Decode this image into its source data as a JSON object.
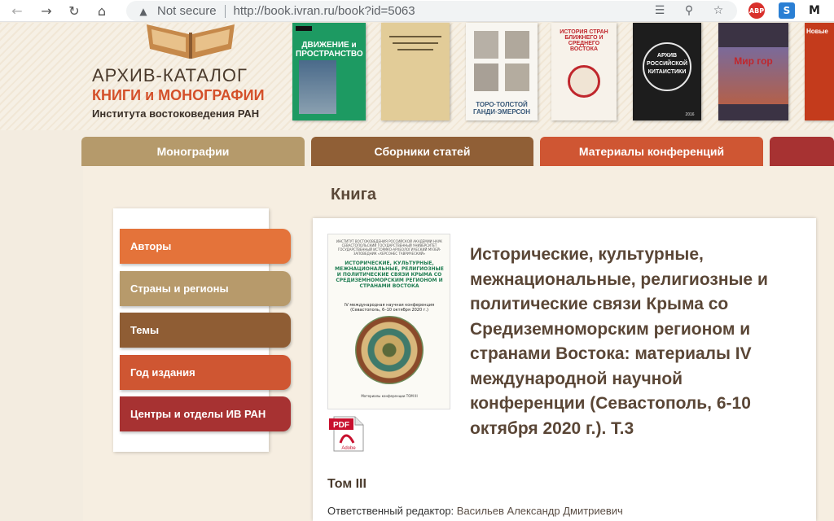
{
  "browser": {
    "not_secure": "Not secure",
    "url": "http://book.ivran.ru/book?id=5063",
    "ext_abp": "ABP",
    "ext_s": "S",
    "ext_m": "M"
  },
  "header": {
    "logo_title": "АРХИВ-КАТАЛОГ",
    "logo_sub1": "КНИГИ и МОНОГРАФИИ",
    "logo_sub2": "Института востоковедения РАН",
    "covers": [
      {
        "text": "ДВИЖЕНИЕ и ПРОСТРАНСТВО"
      },
      {
        "text": ""
      },
      {
        "text": "ТОРО·ТОЛСТОЙ ГАНДИ·ЭМЕРСОН"
      },
      {
        "text": "ИСТОРИЯ СТРАН БЛИЖНЕГО И СРЕДНЕГО ВОСТОКА"
      },
      {
        "text": "АРХИВ РОССИЙСКОЙ КИТАИСТИКИ",
        "year": "2016"
      },
      {
        "text": "Мир гор"
      },
      {
        "text": "Новые"
      }
    ]
  },
  "tabs": [
    {
      "label": "Монографии"
    },
    {
      "label": "Сборники статей"
    },
    {
      "label": "Материалы конференций"
    }
  ],
  "page": {
    "title": "Книга"
  },
  "sidebar": {
    "items": [
      {
        "label": "Авторы"
      },
      {
        "label": "Страны и регионы"
      },
      {
        "label": "Темы"
      },
      {
        "label": "Год издания"
      },
      {
        "label": "Центры и отделы ИВ РАН"
      }
    ]
  },
  "book": {
    "cover_header": "ИНСТИТУТ ВОСТОКОВЕДЕНИЯ РОССИЙСКОЙ АКАДЕМИИ НАУК СЕВАСТОПОЛЬСКИЙ ГОСУДАРСТВЕННЫЙ УНИВЕРСИТЕТ ГОСУДАРСТВЕННЫЙ ИСТОРИКО-АРХЕОЛОГИЧЕСКИЙ МУЗЕЙ-ЗАПОВЕДНИК «ХЕРСОНЕС ТАВРИЧЕСКИЙ»",
    "cover_title": "ИСТОРИЧЕСКИЕ, КУЛЬТУРНЫЕ, МЕЖНАЦИОНАЛЬНЫЕ, РЕЛИГИОЗНЫЕ И ПОЛИТИЧЕСКИЕ СВЯЗИ КРЫМА СО СРЕДИЗЕМНОМОРСКИМ РЕГИОНОМ И СТРАНАМИ ВОСТОКА",
    "cover_sub": "IV международная научная конференция (Севастополь, 6–10 октября 2020 г.)",
    "cover_foot": "Материалы конференции ТОМ III",
    "pdf_label": "PDF",
    "pdf_brand": "Adobe",
    "title": "Исторические, культурные, межнациональные, религиозные и политические связи Крыма со Средиземноморским регионом и странами Востока: материалы IV международной научной конференции (Севастополь, 6-10 октября 2020 г.). Т.3",
    "volume": "Том III",
    "editor_label": "Ответственный редактор:",
    "editor_name": "Васильев Александр Дмитриевич"
  }
}
